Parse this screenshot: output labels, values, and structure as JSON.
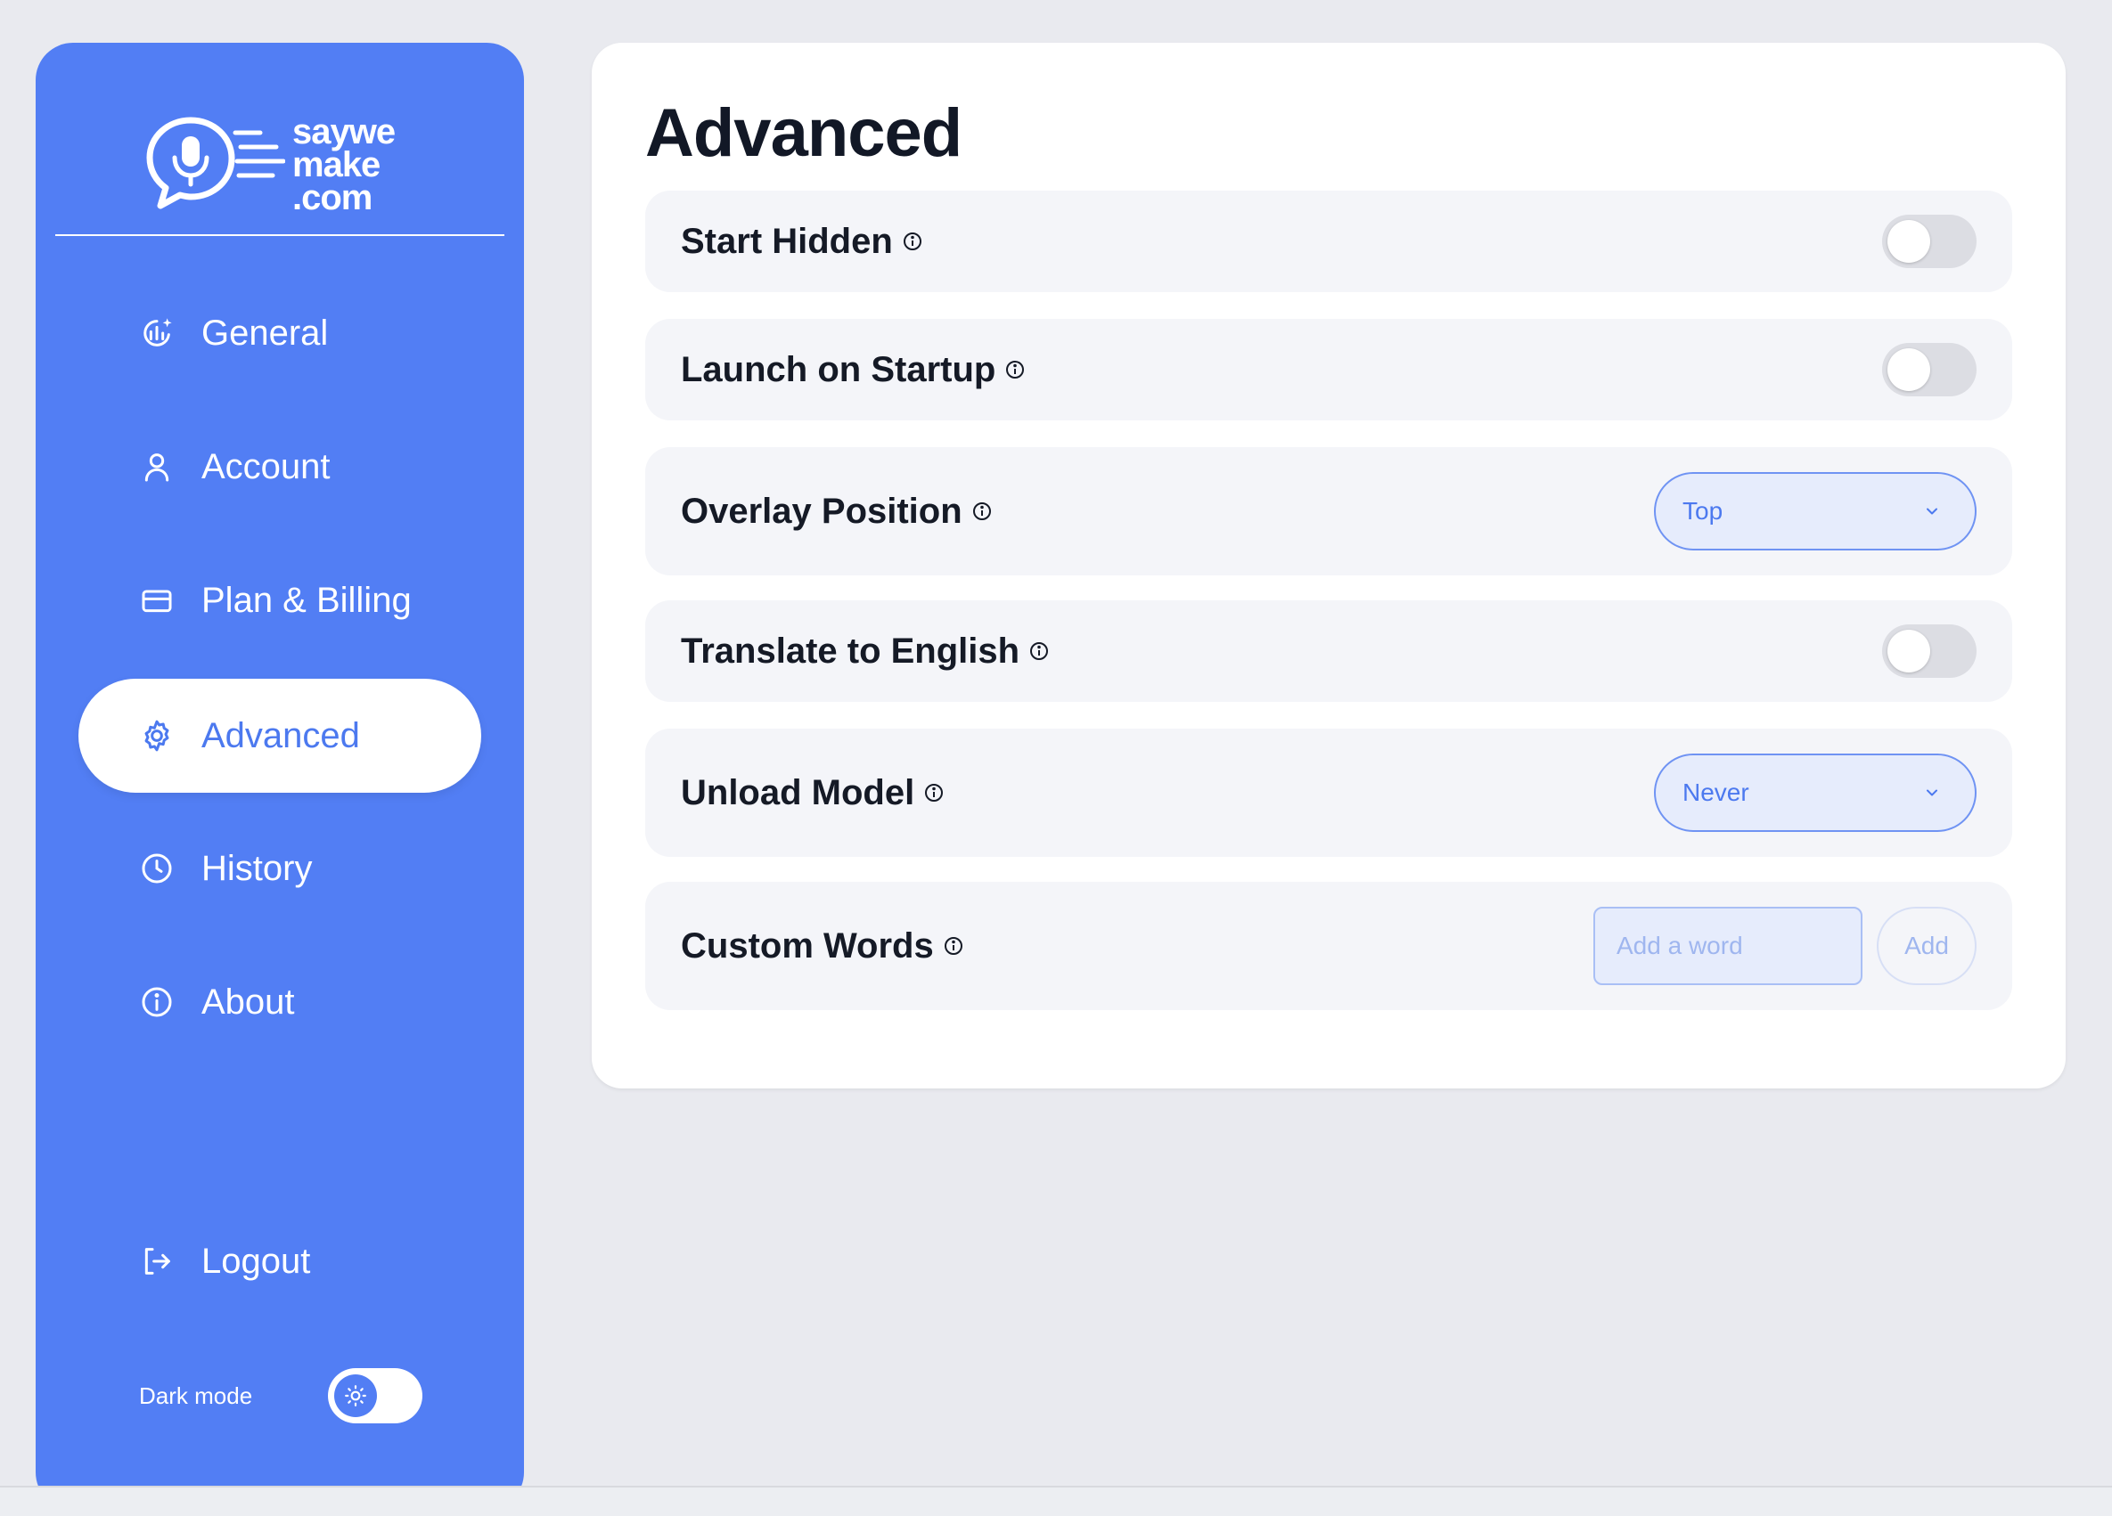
{
  "logo": {
    "line1": "saywe",
    "line2": "make",
    "line3": ".com"
  },
  "sidebar": {
    "items": [
      {
        "label": "General",
        "icon": "spark-chart-icon"
      },
      {
        "label": "Account",
        "icon": "user-icon"
      },
      {
        "label": "Plan & Billing",
        "icon": "credit-card-icon"
      },
      {
        "label": "Advanced",
        "icon": "gear-icon",
        "active": true
      },
      {
        "label": "History",
        "icon": "clock-icon"
      },
      {
        "label": "About",
        "icon": "info-icon"
      }
    ],
    "logout_label": "Logout",
    "dark_mode_label": "Dark mode"
  },
  "main": {
    "title": "Advanced",
    "settings": {
      "start_hidden": {
        "label": "Start Hidden",
        "type": "toggle",
        "on": false
      },
      "launch_on_startup": {
        "label": "Launch on Startup",
        "type": "toggle",
        "on": false
      },
      "overlay_position": {
        "label": "Overlay Position",
        "type": "select",
        "value": "Top"
      },
      "translate_to_english": {
        "label": "Translate to English",
        "type": "toggle",
        "on": false
      },
      "unload_model": {
        "label": "Unload Model",
        "type": "select",
        "value": "Never"
      },
      "custom_words": {
        "label": "Custom Words",
        "placeholder": "Add a word",
        "button_label": "Add"
      }
    }
  },
  "colors": {
    "sidebar_bg": "#527ef4",
    "accent": "#4c79ef",
    "page_bg": "#e9eaef",
    "row_bg": "#f4f5f9",
    "toggle_off": "#dcdde3"
  }
}
